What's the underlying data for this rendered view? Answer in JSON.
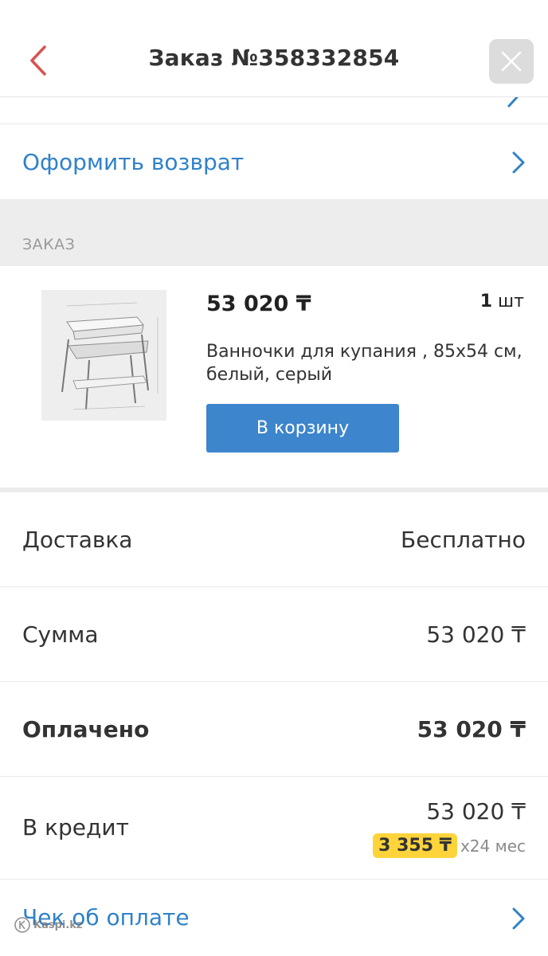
{
  "header": {
    "title": "Заказ №358332854"
  },
  "actions": {
    "return_label": "Оформить возврат"
  },
  "order_section": {
    "heading": "ЗАКАЗ"
  },
  "product": {
    "price": "53 020 ₸",
    "quantity_number": "1",
    "quantity_unit": "шт",
    "name": "Ванночки для купания , 85х54 см, белый, серый",
    "cart_button": "В корзину"
  },
  "summary": {
    "delivery_label": "Доставка",
    "delivery_value": "Бесплатно",
    "sum_label": "Сумма",
    "sum_value": "53 020 ₸",
    "paid_label": "Оплачено",
    "paid_value": "53 020 ₸",
    "credit_label": "В кредит",
    "credit_value": "53 020 ₸",
    "installment_value": "3 355 ₸",
    "installment_term": "x24 мес"
  },
  "receipt": {
    "label": "Чек об оплате"
  },
  "watermark": {
    "text": "Kaspi.kz"
  },
  "colors": {
    "link": "#2f82c9",
    "accent_red": "#d9534f",
    "button_blue": "#3d85cc",
    "installment_pill": "#ffd43b"
  }
}
